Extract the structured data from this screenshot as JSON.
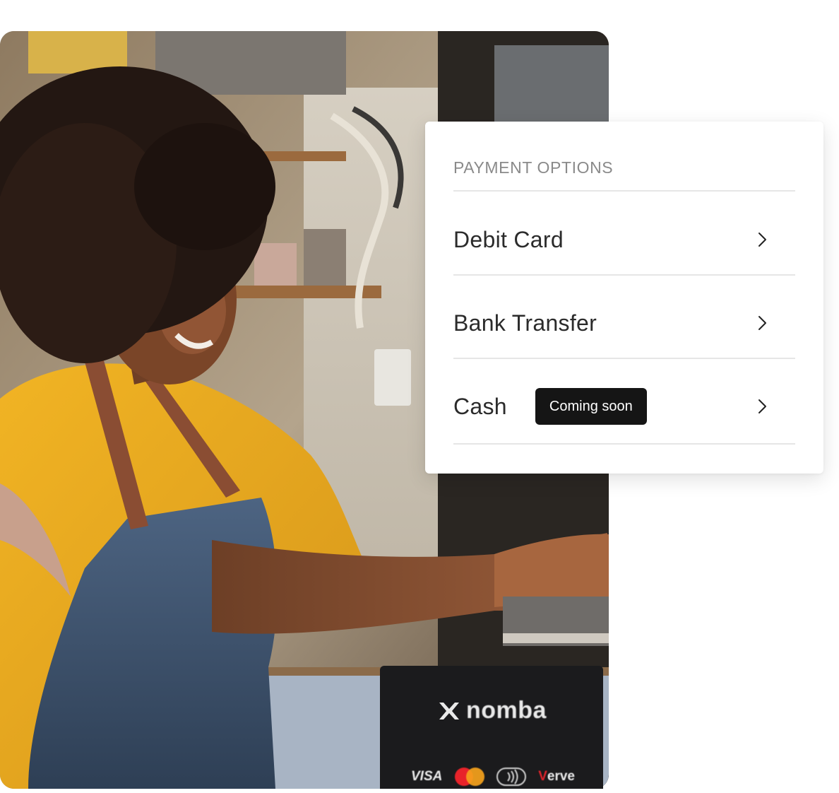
{
  "payment_options": {
    "title": "PAYMENT OPTIONS",
    "options": [
      {
        "label": "Debit Card",
        "icon": "chevron-right-icon"
      },
      {
        "label": "Bank Transfer",
        "icon": "chevron-right-icon"
      },
      {
        "label": "Cash",
        "badge": "Coming soon",
        "icon": "chevron-right-icon"
      }
    ]
  },
  "terminal": {
    "brand": "nomba",
    "card_networks": {
      "visa": "VISA",
      "mastercard": "mastercard-logo-icon",
      "contactless": "contactless-icon",
      "verve_first": "V",
      "verve_rest": "erve"
    }
  },
  "colors": {
    "badge_bg": "#151515",
    "title_text": "#8a8a8a",
    "option_text": "#2b2b2b",
    "shirt": "#e8a91c",
    "apron": "#3f5470"
  }
}
